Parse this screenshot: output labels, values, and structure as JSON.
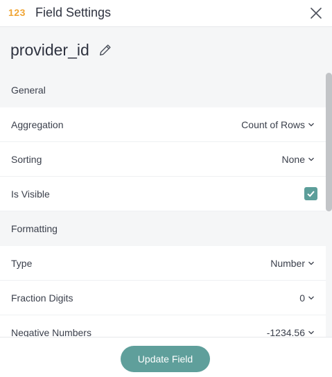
{
  "header": {
    "type_badge": "123",
    "title": "Field Settings",
    "close_icon": "close-icon"
  },
  "field": {
    "name": "provider_id",
    "edit_icon": "pencil-icon"
  },
  "sections": {
    "general": "General",
    "formatting": "Formatting"
  },
  "rows": {
    "aggregation": {
      "label": "Aggregation",
      "value": "Count of Rows"
    },
    "sorting": {
      "label": "Sorting",
      "value": "None"
    },
    "is_visible": {
      "label": "Is Visible",
      "checked": true
    },
    "type": {
      "label": "Type",
      "value": "Number"
    },
    "fraction_digits": {
      "label": "Fraction Digits",
      "value": "0"
    },
    "negative_numbers": {
      "label": "Negative Numbers",
      "value": "-1234.56"
    }
  },
  "footer": {
    "update_label": "Update Field"
  },
  "colors": {
    "accent": "#5f9f9b",
    "badge": "#f0a535",
    "section_bg": "#f5f6f7"
  }
}
